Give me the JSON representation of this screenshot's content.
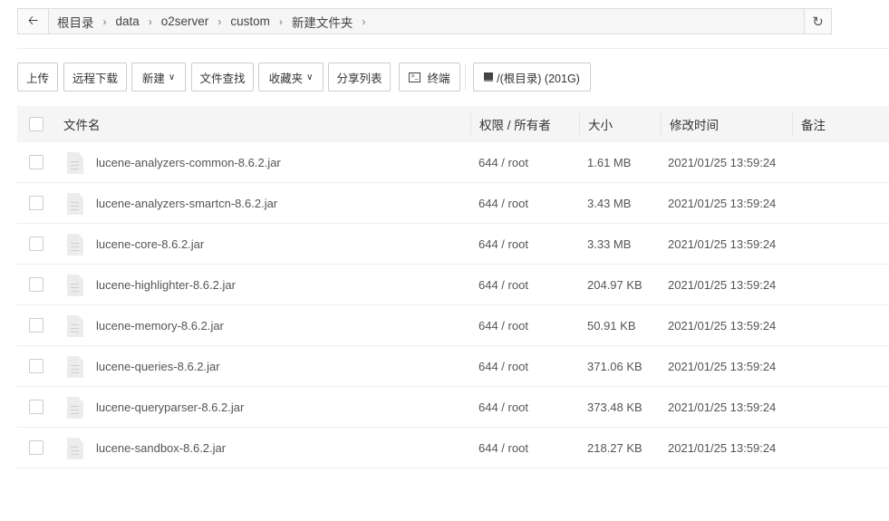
{
  "breadcrumb": {
    "items": [
      "根目录",
      "data",
      "o2server",
      "custom",
      "新建文件夹"
    ]
  },
  "toolbar": {
    "upload": "上传",
    "remote_download": "远程下载",
    "new": "新建",
    "file_search": "文件查找",
    "favorites": "收藏夹",
    "share_list": "分享列表",
    "terminal": "终端",
    "disk": "/(根目录) (201G)"
  },
  "table": {
    "headers": {
      "name": "文件名",
      "perm": "权限 / 所有者",
      "size": "大小",
      "mtime": "修改时间",
      "note": "备注"
    },
    "rows": [
      {
        "name": "lucene-analyzers-common-8.6.2.jar",
        "perm": "644 / root",
        "size": "1.61 MB",
        "mtime": "2021/01/25 13:59:24"
      },
      {
        "name": "lucene-analyzers-smartcn-8.6.2.jar",
        "perm": "644 / root",
        "size": "3.43 MB",
        "mtime": "2021/01/25 13:59:24"
      },
      {
        "name": "lucene-core-8.6.2.jar",
        "perm": "644 / root",
        "size": "3.33 MB",
        "mtime": "2021/01/25 13:59:24"
      },
      {
        "name": "lucene-highlighter-8.6.2.jar",
        "perm": "644 / root",
        "size": "204.97 KB",
        "mtime": "2021/01/25 13:59:24"
      },
      {
        "name": "lucene-memory-8.6.2.jar",
        "perm": "644 / root",
        "size": "50.91 KB",
        "mtime": "2021/01/25 13:59:24"
      },
      {
        "name": "lucene-queries-8.6.2.jar",
        "perm": "644 / root",
        "size": "371.06 KB",
        "mtime": "2021/01/25 13:59:24"
      },
      {
        "name": "lucene-queryparser-8.6.2.jar",
        "perm": "644 / root",
        "size": "373.48 KB",
        "mtime": "2021/01/25 13:59:24"
      },
      {
        "name": "lucene-sandbox-8.6.2.jar",
        "perm": "644 / root",
        "size": "218.27 KB",
        "mtime": "2021/01/25 13:59:24"
      }
    ]
  }
}
